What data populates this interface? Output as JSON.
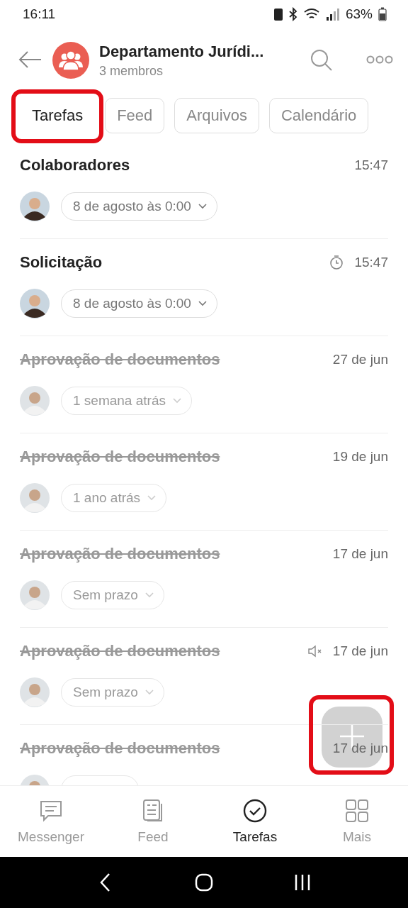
{
  "status_bar": {
    "time": "16:11",
    "battery": "63%"
  },
  "header": {
    "title": "Departamento Jurídi...",
    "subtitle": "3 membros"
  },
  "tabs": [
    {
      "label": "Tarefas",
      "selected": true,
      "highlighted": true
    },
    {
      "label": "Feed",
      "selected": false,
      "highlighted": false
    },
    {
      "label": "Arquivos",
      "selected": false,
      "highlighted": false
    },
    {
      "label": "Calendário",
      "selected": false,
      "highlighted": false
    }
  ],
  "tasks": [
    {
      "title": "Colaboradores",
      "time": "15:47",
      "completed": false,
      "deadline": "8 de agosto às 0:00",
      "timer": false,
      "muted": false
    },
    {
      "title": "Solicitação",
      "time": "15:47",
      "completed": false,
      "deadline": "8 de agosto às 0:00",
      "timer": true,
      "muted": false
    },
    {
      "title": "Aprovação de documentos",
      "time": "27 de jun",
      "completed": true,
      "deadline": "1 semana atrás",
      "timer": false,
      "muted": false
    },
    {
      "title": "Aprovação de documentos",
      "time": "19 de jun",
      "completed": true,
      "deadline": "1 ano atrás",
      "timer": false,
      "muted": false
    },
    {
      "title": "Aprovação de documentos",
      "time": "17 de jun",
      "completed": true,
      "deadline": "Sem prazo",
      "timer": false,
      "muted": false
    },
    {
      "title": "Aprovação de documentos",
      "time": "17 de jun",
      "completed": true,
      "deadline": "Sem prazo",
      "timer": false,
      "muted": true
    },
    {
      "title": "Aprovação de documentos",
      "time": "17 de jun",
      "completed": true,
      "timer": false,
      "muted": false
    }
  ],
  "fab": {
    "highlighted": true
  },
  "bottom_nav": [
    {
      "label": "Messenger",
      "selected": false,
      "kind": "chat"
    },
    {
      "label": "Feed",
      "selected": false,
      "kind": "feed"
    },
    {
      "label": "Tarefas",
      "selected": true,
      "kind": "tasks"
    },
    {
      "label": "Mais",
      "selected": false,
      "kind": "grid"
    }
  ]
}
